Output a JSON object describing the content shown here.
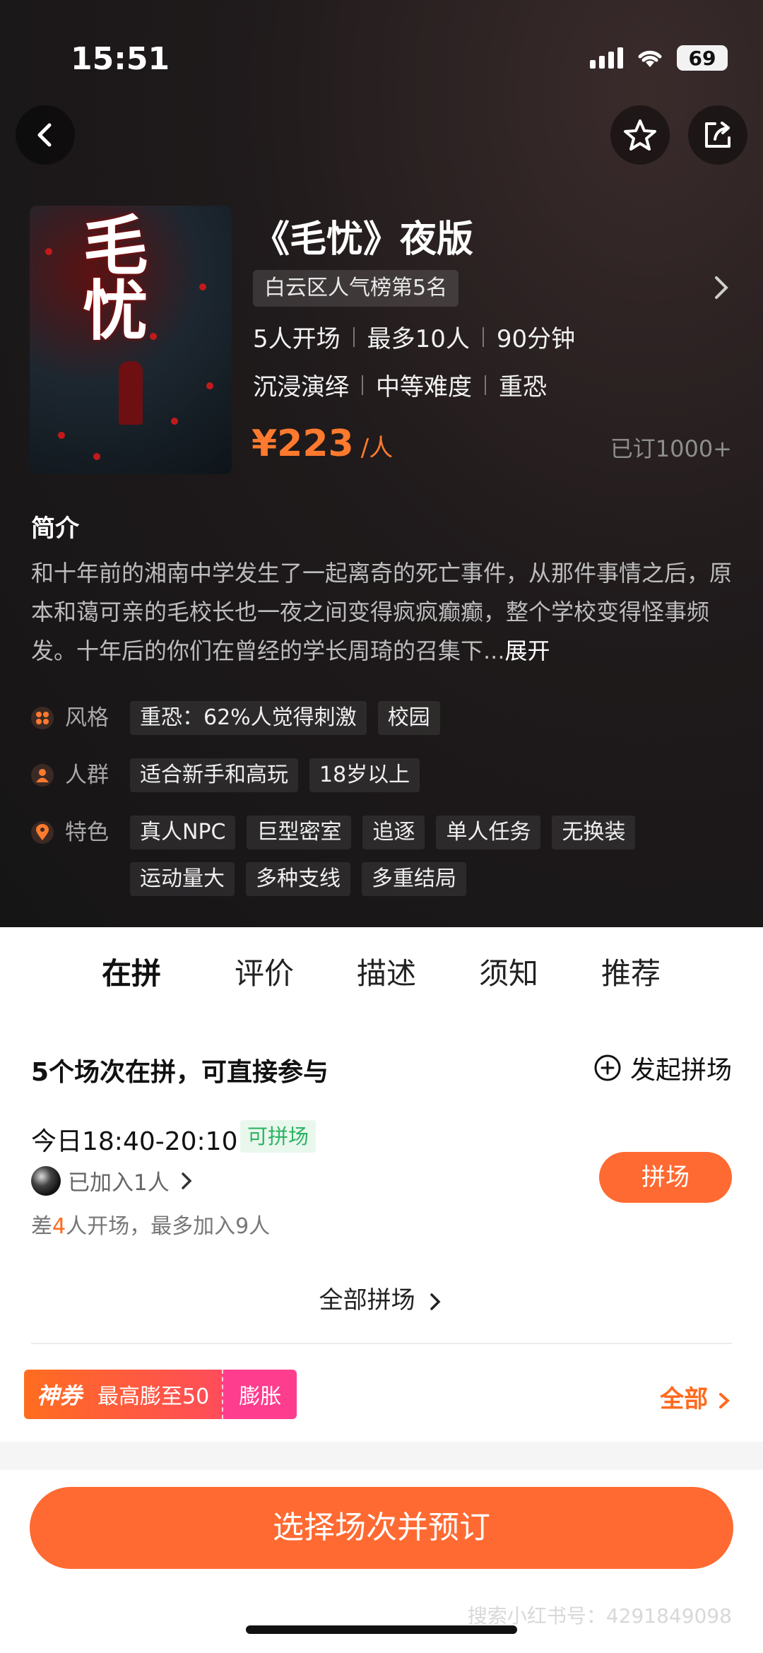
{
  "status": {
    "time": "15:51",
    "battery": "69"
  },
  "show": {
    "title": "《毛忧》夜版",
    "poster_text": "毛忧",
    "rank": "白云区人气榜第5名",
    "meta1": [
      "5人开场",
      "最多10人",
      "90分钟"
    ],
    "meta2": [
      "沉浸演绎",
      "中等难度",
      "重恐"
    ],
    "price": "¥223",
    "price_unit": "/人",
    "sold": "已订1000+"
  },
  "intro": {
    "heading": "简介",
    "text": "和十年前的湘南中学发生了一起离奇的死亡事件，从那件事情之后，原本和蔼可亲的毛校长也一夜之间变得疯疯癫癫，整个学校变得怪事频发。十年后的你们在曾经的学长周琦的召集下...",
    "more": "展开"
  },
  "tags": [
    {
      "label": "风格",
      "icon": "style-icon",
      "chips": [
        "重恐：62%人觉得刺激",
        "校园"
      ]
    },
    {
      "label": "人群",
      "icon": "person-icon",
      "chips": [
        "适合新手和高玩",
        "18岁以上"
      ]
    },
    {
      "label": "特色",
      "icon": "location-pin-icon",
      "chips": [
        "真人NPC",
        "巨型密室",
        "追逐",
        "单人任务",
        "无换装",
        "运动量大",
        "多种支线",
        "多重结局"
      ]
    }
  ],
  "tabs": [
    "在拼",
    "评价",
    "描述",
    "须知",
    "推荐"
  ],
  "group": {
    "heading": "5个场次在拼，可直接参与",
    "start_label": "发起拼场",
    "slot_time": "今日18:40-20:10",
    "slot_badge": "可拼场",
    "joined": "已加入1人",
    "need_prefix": "差",
    "need_num": "4",
    "need_suffix": "人开场，最多加入9人",
    "join_button": "拼场",
    "all_link": "全部拼场"
  },
  "coupon": {
    "tag": "神券",
    "text": "最高膨至50",
    "expand": "膨胀",
    "all": "全部"
  },
  "cta": "选择场次并预订",
  "watermark": "搜索小红书号：4291849098",
  "colors": {
    "accent": "#ff6a32",
    "price": "#ff7a2e",
    "green": "#2db463"
  }
}
